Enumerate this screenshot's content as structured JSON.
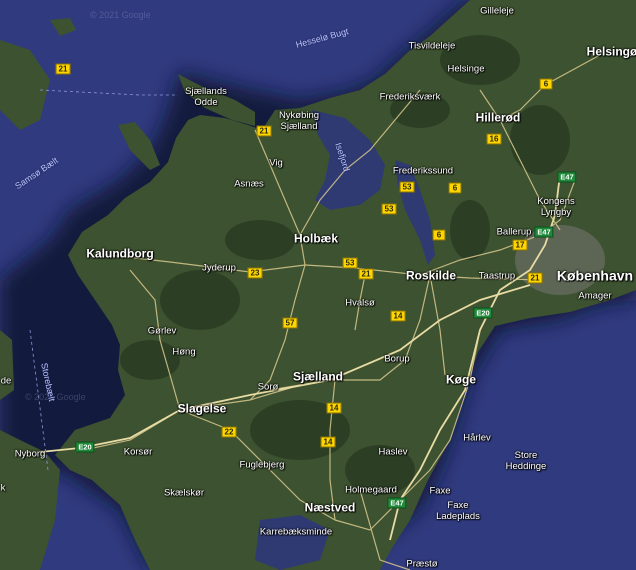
{
  "map": {
    "copyright": "© 2021 Google",
    "colors": {
      "sea": "#303a7e",
      "land": "#3d5230",
      "forest": "#2c3f24",
      "road": "#d9c98e",
      "lake": "#233a52"
    },
    "water_labels": {
      "hesselo_bugt": "Hesselø Bugt",
      "samso_baelt": "Samsø Bælt",
      "storebaelt": "Storebælt",
      "isefjord": "Isefjord"
    },
    "places": {
      "gilleleje": "Gilleleje",
      "tisvildeleje": "Tisvildeleje",
      "helsinge": "Helsinge",
      "helsingor": "Helsingø",
      "sjaellands_odde": "Sjællands\nOdde",
      "nykobing_sjaelland": "Nykøbing\nSjælland",
      "frederiksvaerk": "Frederiksværk",
      "hillerod": "Hillerød",
      "vig": "Vig",
      "frederikssund": "Frederikssund",
      "asnaes": "Asnæs",
      "kongens_lyngby": "Kongens\nLyngby",
      "holbaek": "Holbæk",
      "ballerup": "Ballerup",
      "kalundborg": "Kalundborg",
      "jyderup": "Jyderup",
      "roskilde": "Roskilde",
      "taastrup": "Taastrup",
      "kobenhavn": "København",
      "amager": "Amager",
      "hvalso": "Hvalsø",
      "gorlev": "Gørlev",
      "hong": "Høng",
      "borup": "Borup",
      "soro": "Sorø",
      "sjaelland": "Sjælland",
      "koge": "Køge",
      "slagelse": "Slagelse",
      "nyborg": "Nyborg",
      "korsor": "Korsør",
      "haslev": "Haslev",
      "harlev": "Hårlev",
      "store_heddinge": "Store\nHeddinge",
      "fuglebjerg": "Fuglebjerg",
      "skaelskor": "Skælskør",
      "holmegaard": "Holmegaard",
      "faxe": "Faxe",
      "faxe_ladeplads": "Faxe\nLadeplads",
      "naestved": "Næstved",
      "karrebaeksminde": "Karrebæksminde",
      "praesto": "Præstø",
      "left_edge_de": "de",
      "left_edge_k": "k"
    },
    "route_shields": {
      "r21_sea": "21",
      "r21_odde": "21",
      "r6_north": "6",
      "r16": "16",
      "r53_a": "53",
      "r6_mid": "6",
      "r53_b": "53",
      "r6_low": "6",
      "r17": "17",
      "r23": "23",
      "r53_c": "53",
      "r21_east": "21",
      "r21_kbh": "21",
      "r57": "57",
      "r14_a": "14",
      "r14_b": "14",
      "r22": "22",
      "r14_c": "14"
    },
    "e_shields": {
      "e47_north": "E47",
      "e47_mid": "E47",
      "e20_east": "E20",
      "e20_west": "E20",
      "e47_south": "E47"
    }
  }
}
